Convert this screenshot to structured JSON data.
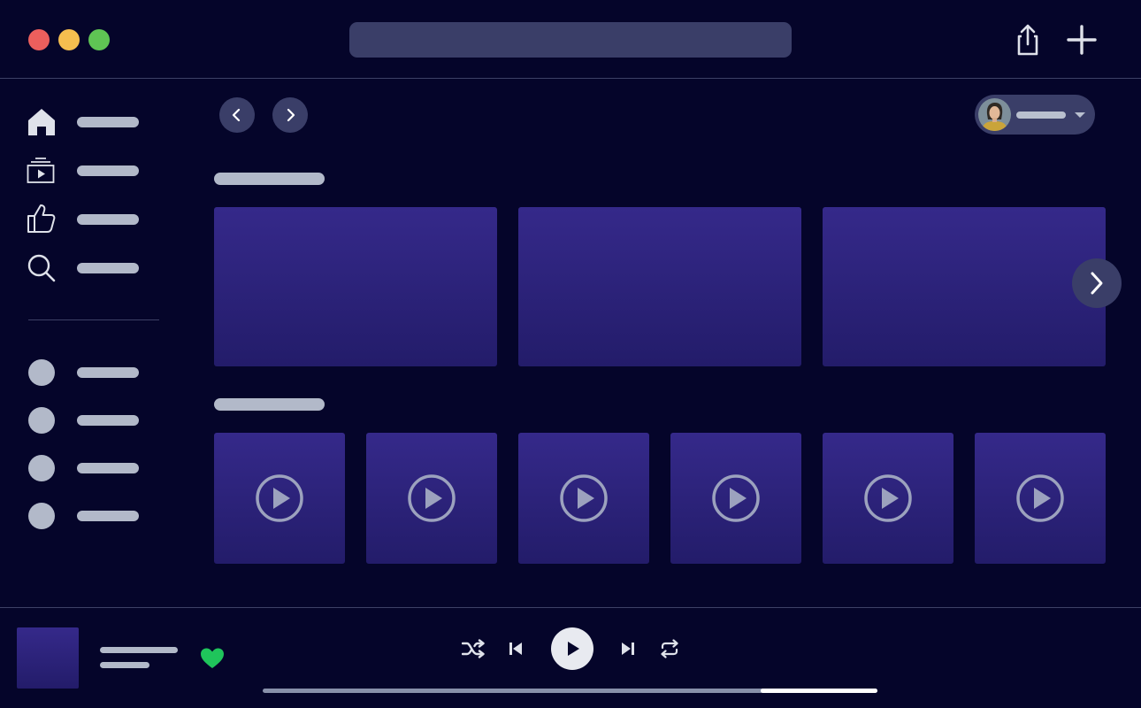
{
  "window": {
    "traffic_lights": [
      {
        "name": "close",
        "color": "#ec5f5d"
      },
      {
        "name": "minimize",
        "color": "#f5be4f"
      },
      {
        "name": "zoom",
        "color": "#5fc454"
      }
    ],
    "search": {
      "value": "",
      "placeholder": ""
    }
  },
  "toolbar": {
    "share_icon": "share-icon",
    "add_icon": "plus-icon"
  },
  "sidebar": {
    "nav_items": [
      {
        "icon": "home-icon",
        "label": ""
      },
      {
        "icon": "library-icon",
        "label": ""
      },
      {
        "icon": "thumbs-up-icon",
        "label": ""
      },
      {
        "icon": "search-icon",
        "label": ""
      }
    ],
    "playlists": [
      {
        "label": ""
      },
      {
        "label": ""
      },
      {
        "label": ""
      },
      {
        "label": ""
      }
    ]
  },
  "main": {
    "nav": {
      "back_icon": "chevron-left-icon",
      "forward_icon": "chevron-right-icon"
    },
    "profile": {
      "name": "",
      "menu_icon": "caret-down-icon"
    },
    "sections": [
      {
        "title": "",
        "cards": 3
      },
      {
        "title": "",
        "cards": 6
      }
    ]
  },
  "player": {
    "track_title": "",
    "artist": "",
    "liked": true,
    "colors": {
      "accent": "#1fc55b",
      "surface": "#3a3e68",
      "card": "#2d2479"
    },
    "progress": 0.81
  }
}
